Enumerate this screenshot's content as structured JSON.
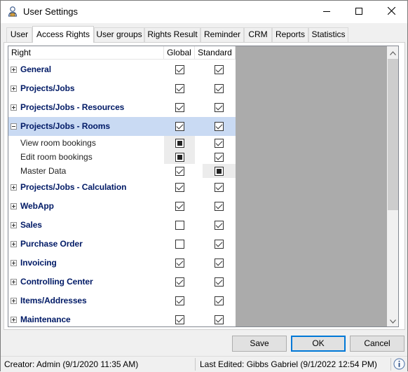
{
  "window": {
    "title": "User Settings"
  },
  "tabs": [
    {
      "label": "User",
      "active": false
    },
    {
      "label": "Access Rights",
      "active": true
    },
    {
      "label": "User groups",
      "active": false
    },
    {
      "label": "Rights Result",
      "active": false
    },
    {
      "label": "Reminder",
      "active": false
    },
    {
      "label": "CRM",
      "active": false
    },
    {
      "label": "Reports",
      "active": false
    },
    {
      "label": "Statistics",
      "active": false
    }
  ],
  "grid": {
    "headers": {
      "right": "Right",
      "global": "Global",
      "standard": "Standard"
    },
    "rows": [
      {
        "type": "group",
        "label": "General",
        "expanded": false,
        "global": "checked",
        "standard": "checked"
      },
      {
        "type": "group",
        "label": "Projects/Jobs",
        "expanded": false,
        "global": "checked",
        "standard": "checked"
      },
      {
        "type": "group",
        "label": "Projects/Jobs - Resources",
        "expanded": false,
        "global": "checked",
        "standard": "checked"
      },
      {
        "type": "group",
        "label": "Projects/Jobs - Rooms",
        "expanded": true,
        "selected": true,
        "global": "checked",
        "standard": "checked"
      },
      {
        "type": "sub",
        "label": "View room bookings",
        "global": "indeterminate",
        "standard": "checked",
        "shade": "global"
      },
      {
        "type": "sub",
        "label": "Edit room bookings",
        "global": "indeterminate",
        "standard": "checked",
        "shade": "global"
      },
      {
        "type": "sub",
        "label": "Master Data",
        "global": "checked",
        "standard": "indeterminate",
        "shade": "standard"
      },
      {
        "type": "group",
        "label": "Projects/Jobs - Calculation",
        "expanded": false,
        "global": "checked",
        "standard": "checked"
      },
      {
        "type": "group",
        "label": "WebApp",
        "expanded": false,
        "global": "checked",
        "standard": "checked"
      },
      {
        "type": "group",
        "label": "Sales",
        "expanded": false,
        "global": "unchecked",
        "standard": "checked"
      },
      {
        "type": "group",
        "label": "Purchase Order",
        "expanded": false,
        "global": "unchecked",
        "standard": "checked"
      },
      {
        "type": "group",
        "label": "Invoicing",
        "expanded": false,
        "global": "checked",
        "standard": "checked"
      },
      {
        "type": "group",
        "label": "Controlling Center",
        "expanded": false,
        "global": "checked",
        "standard": "checked"
      },
      {
        "type": "group",
        "label": "Items/Addresses",
        "expanded": false,
        "global": "checked",
        "standard": "checked"
      },
      {
        "type": "group",
        "label": "Maintenance",
        "expanded": false,
        "global": "checked",
        "standard": "checked"
      }
    ]
  },
  "buttons": {
    "save": "Save",
    "ok": "OK",
    "cancel": "Cancel"
  },
  "status": {
    "creator": "Creator: Admin  (9/1/2020 11:35 AM)",
    "last_edited": "Last Edited:  Gibbs Gabriel (9/1/2022 12:54 PM)"
  },
  "icons": {
    "app": "user-settings-icon",
    "minimize": "minimize-icon",
    "maximize": "maximize-icon",
    "close": "close-icon",
    "info": "info-icon"
  },
  "colors": {
    "selected_row": "#c9daf3",
    "group_text": "#001a66",
    "default_button_border": "#0078d7",
    "empty_grid_area": "#ababab"
  }
}
